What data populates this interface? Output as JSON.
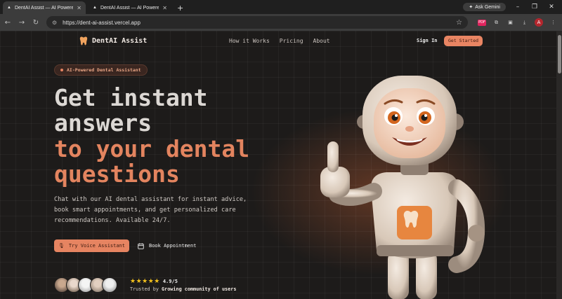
{
  "browser": {
    "tabs": [
      {
        "title": "DentAI Assist — AI Powered De"
      },
      {
        "title": "DentAI Assist — AI Powered De"
      }
    ],
    "new_tab": "+",
    "ask_gemini": "Ask Gemini",
    "url": "https://dent-ai-assist.vercel.app",
    "profile_initial": "A"
  },
  "nav": {
    "brand": "DentAI Assist",
    "links": [
      "How it Works",
      "Pricing",
      "About"
    ],
    "sign_in": "Sign In",
    "get_started": "Get Started"
  },
  "hero": {
    "badge": "AI-Powered Dental Assistant",
    "title_line1": "Get instant",
    "title_line2": "answers",
    "title_line3": "to your dental",
    "title_line4": "questions",
    "description": "Chat with our AI dental assistant for instant advice, book smart appointments, and get personalized care recommendations. Available 24/7.",
    "primary_button": "Try Voice Assistant",
    "secondary_button": "Book Appointment",
    "rating": "4.9/5",
    "trusted_prefix": "Trusted by",
    "trusted_bold": "Growing community of users"
  },
  "colors": {
    "accent": "#e68461",
    "background": "#1d1b1a",
    "star": "#f4c21c"
  }
}
